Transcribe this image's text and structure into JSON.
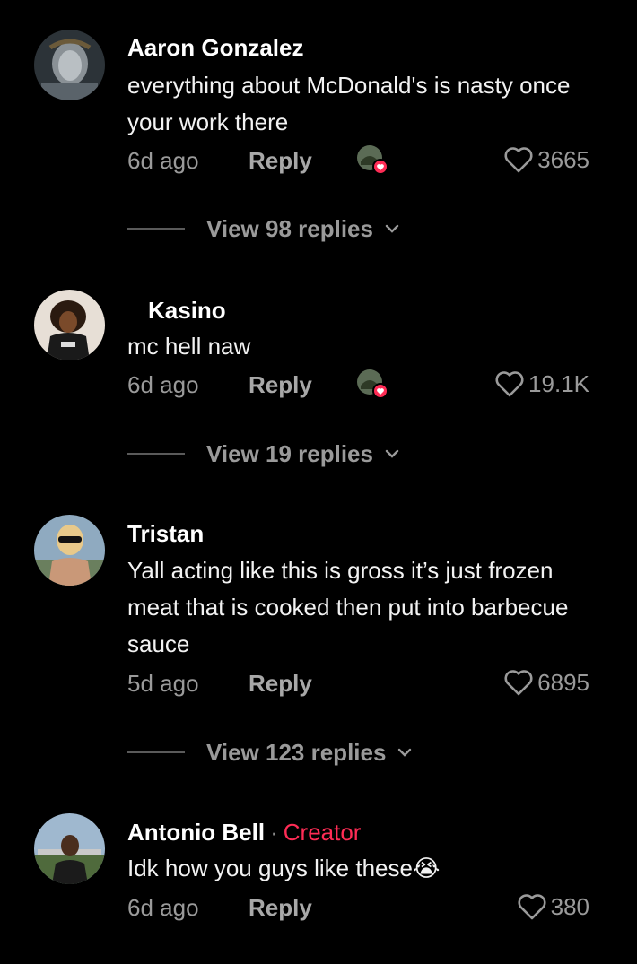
{
  "colors": {
    "background": "#000000",
    "text": "#f2f2f2",
    "muted": "#9a9a9a",
    "creator_accent": "#fe2c55",
    "heart_badge": "#fe2c55"
  },
  "comments": [
    {
      "username": "Aaron Gonzalez",
      "text": "everything about McDonald's is nasty once your work there",
      "time": "6d ago",
      "reply_label": "Reply",
      "likes": "3665",
      "liked_by_creator": true,
      "view_replies": "View 98 replies",
      "avatar": "jesus-statue-avatar"
    },
    {
      "username": "Kasino",
      "text": "mc hell naw",
      "time": "6d ago",
      "reply_label": "Reply",
      "likes": "19.1K",
      "liked_by_creator": true,
      "view_replies": "View 19 replies",
      "avatar": "person-avatar"
    },
    {
      "username": "Tristan",
      "text": "Yall acting like this is gross it’s just frozen meat that is cooked then put into barbecue sauce",
      "time": "5d ago",
      "reply_label": "Reply",
      "likes": "6895",
      "liked_by_creator": false,
      "view_replies": "View 123 replies",
      "avatar": "person-sunglasses-avatar"
    },
    {
      "username": "Antonio Bell",
      "separator": "·",
      "badge": "Creator",
      "text": "Idk how you guys like these",
      "emoji": "😭",
      "time": "6d ago",
      "reply_label": "Reply",
      "likes": "380",
      "liked_by_creator": false,
      "avatar": "creator-avatar"
    }
  ]
}
